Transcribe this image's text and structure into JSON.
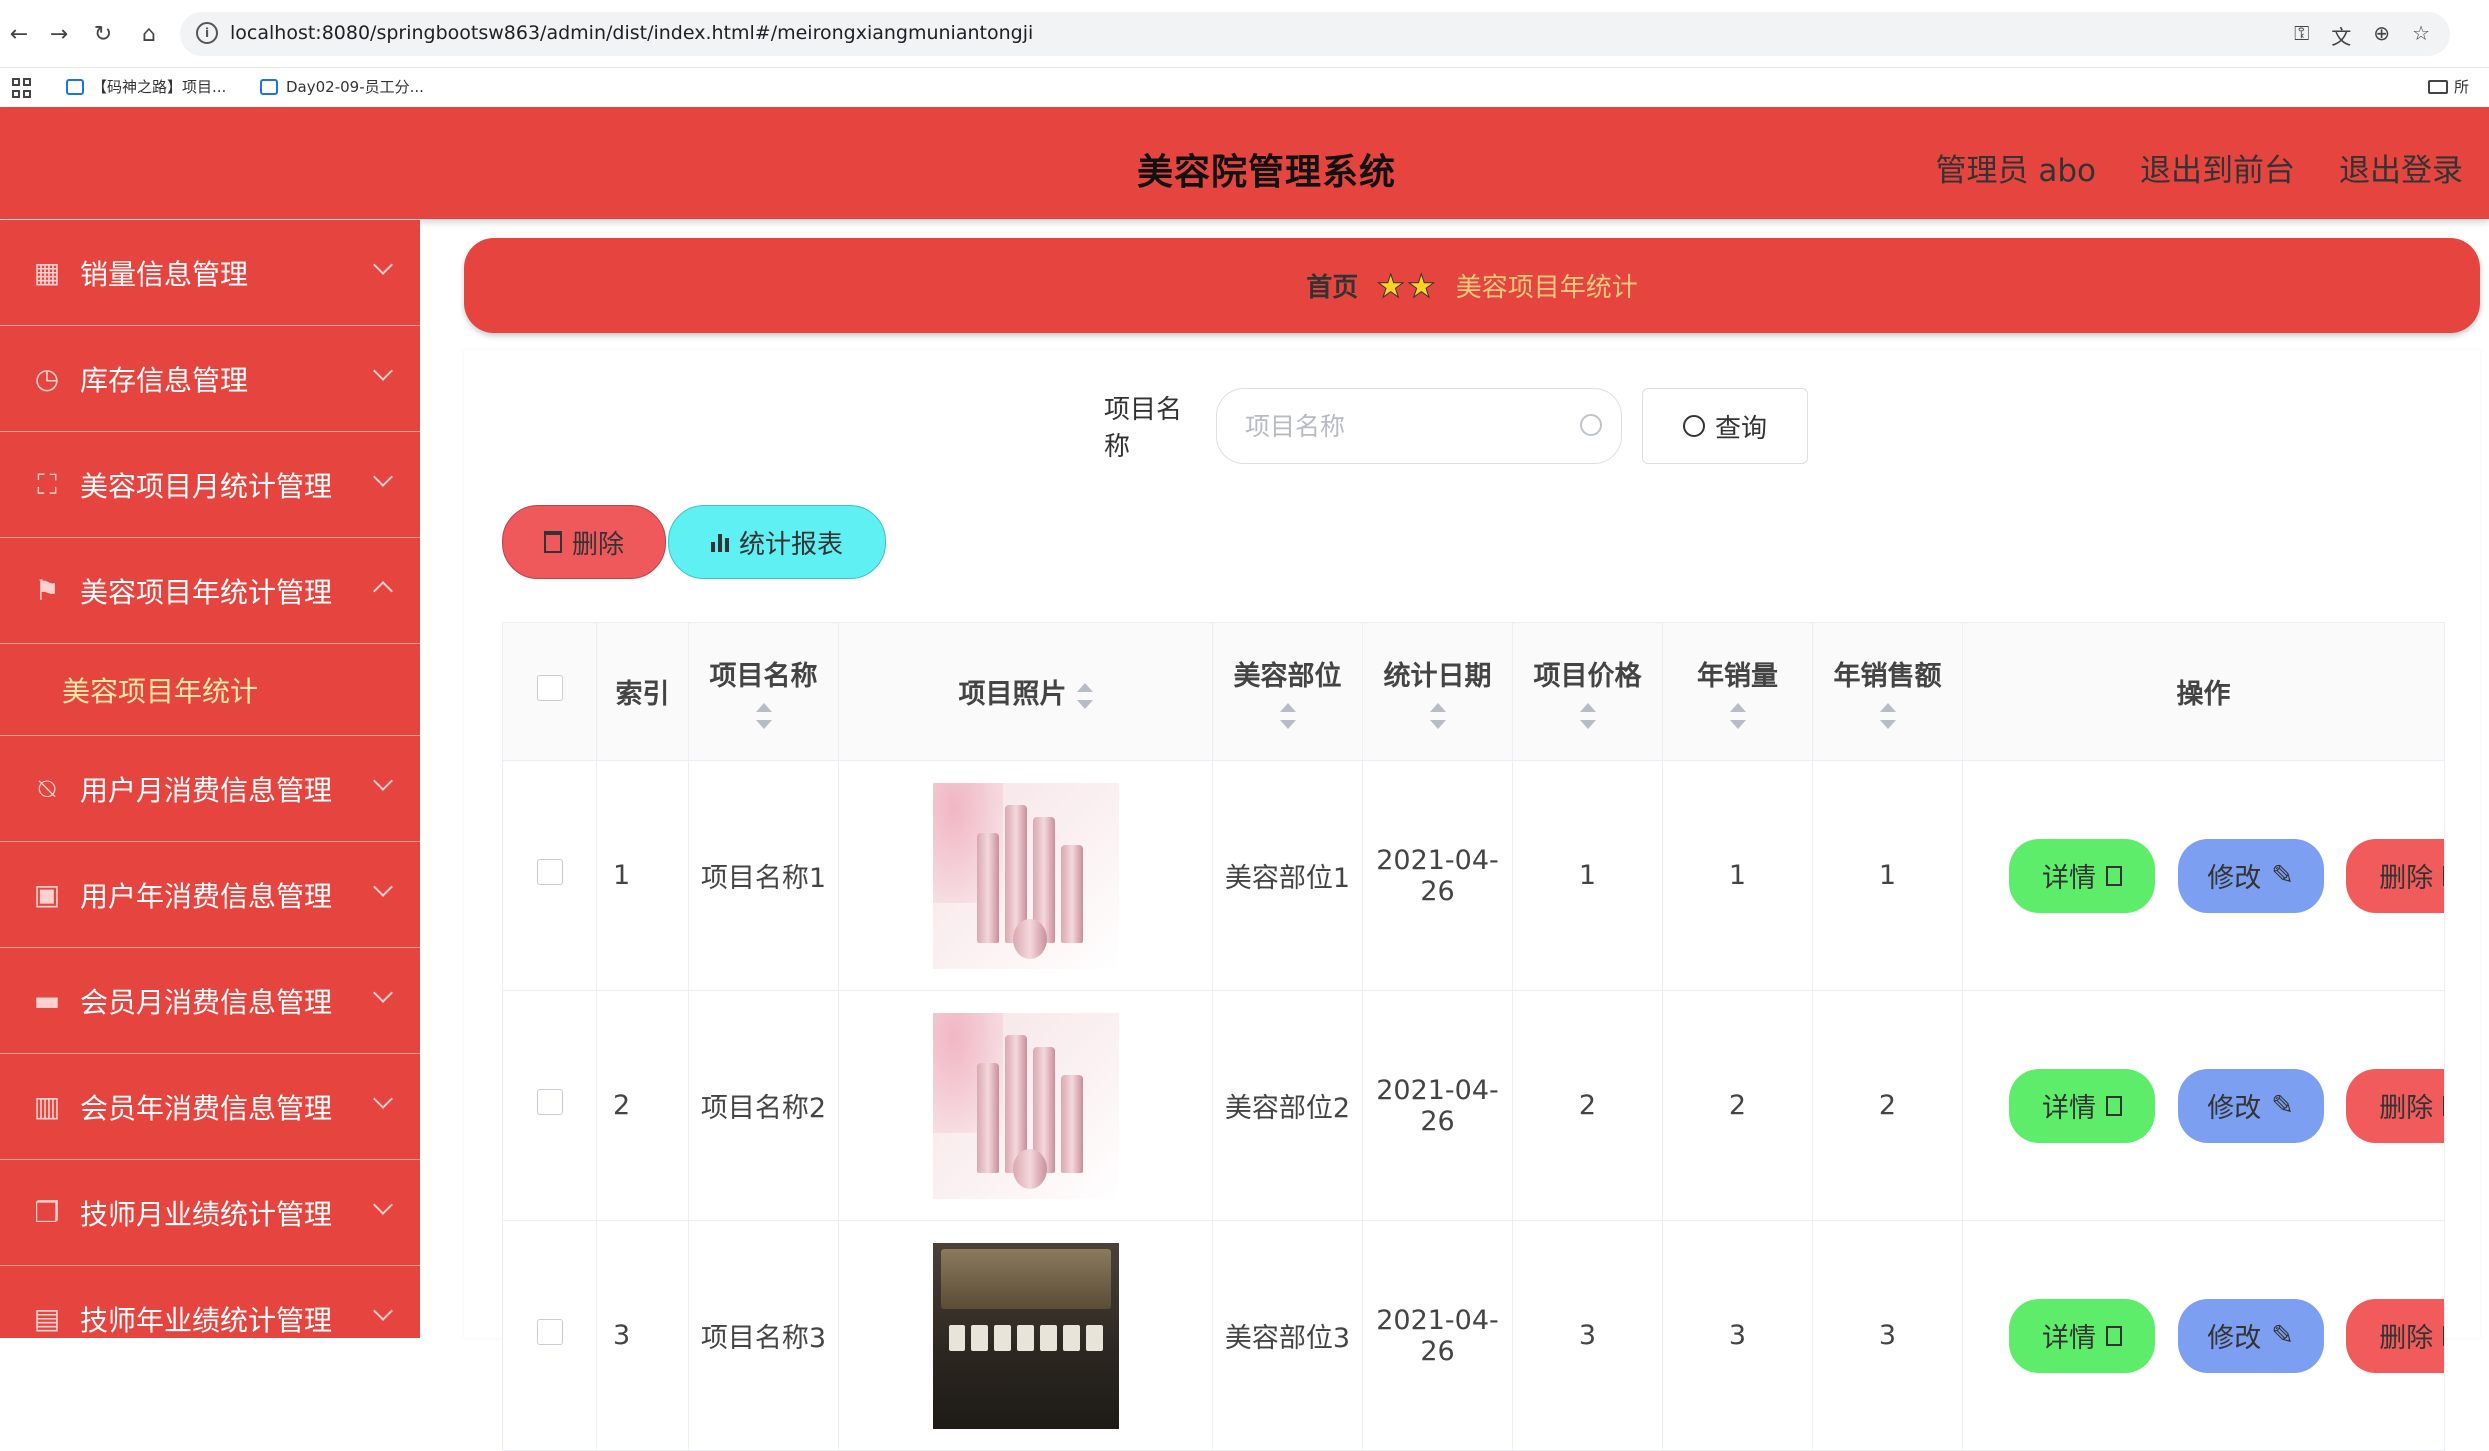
{
  "browser": {
    "url": "localhost:8080/springbootsw863/admin/dist/index.html#/meirongxiangmuniantongji",
    "bookmarks": [
      "【码神之路】项目...",
      "Day02-09-员工分..."
    ],
    "bookmarks_folder": "所"
  },
  "header": {
    "title": "美容院管理系统",
    "user": "管理员 abo",
    "to_front": "退出到前台",
    "logout": "退出登录"
  },
  "sidebar": {
    "items": [
      {
        "label": "销量信息管理",
        "icon": "grid-icon"
      },
      {
        "label": "库存信息管理",
        "icon": "clock-icon"
      },
      {
        "label": "美容项目月统计管理",
        "icon": "frame-icon"
      },
      {
        "label": "美容项目年统计管理",
        "icon": "flag-icon",
        "expanded": true
      },
      {
        "label": "用户月消费信息管理",
        "icon": "bell-off-icon"
      },
      {
        "label": "用户年消费信息管理",
        "icon": "apps-icon"
      },
      {
        "label": "会员月消费信息管理",
        "icon": "ticket-icon"
      },
      {
        "label": "会员年消费信息管理",
        "icon": "books-icon"
      },
      {
        "label": "技师月业绩统计管理",
        "icon": "copy-icon"
      },
      {
        "label": "技师年业绩统计管理",
        "icon": "briefcase-icon"
      }
    ],
    "sub_item": "美容项目年统计"
  },
  "breadcrumb": {
    "home": "首页",
    "separator": "★★",
    "current": "美容项目年统计"
  },
  "search": {
    "label": "项目名称",
    "placeholder": "项目名称",
    "button": "查询"
  },
  "actions": {
    "delete": "删除",
    "report": "统计报表"
  },
  "table": {
    "headers": {
      "index": "索引",
      "name": "项目名称",
      "photo": "项目照片",
      "part": "美容部位",
      "date": "统计日期",
      "price": "项目价格",
      "annual_sales": "年销量",
      "annual_revenue": "年销售额",
      "ops": "操作"
    },
    "rows": [
      {
        "index": "1",
        "name": "项目名称1",
        "part": "美容部位1",
        "date": "2021-04-26",
        "price": "1",
        "sales": "1",
        "revenue": "1",
        "photo": "pink"
      },
      {
        "index": "2",
        "name": "项目名称2",
        "part": "美容部位2",
        "date": "2021-04-26",
        "price": "2",
        "sales": "2",
        "revenue": "2",
        "photo": "pink"
      },
      {
        "index": "3",
        "name": "项目名称3",
        "part": "美容部位3",
        "date": "2021-04-26",
        "price": "3",
        "sales": "3",
        "revenue": "3",
        "photo": "dark"
      }
    ],
    "op_labels": {
      "detail": "详情",
      "edit": "修改",
      "delete": "删除"
    }
  },
  "colors": {
    "primary": "#e6453f",
    "detail": "#5ded6b",
    "edit": "#7c9ff2",
    "delete": "#f15b5b",
    "report": "#5ff0f4"
  }
}
